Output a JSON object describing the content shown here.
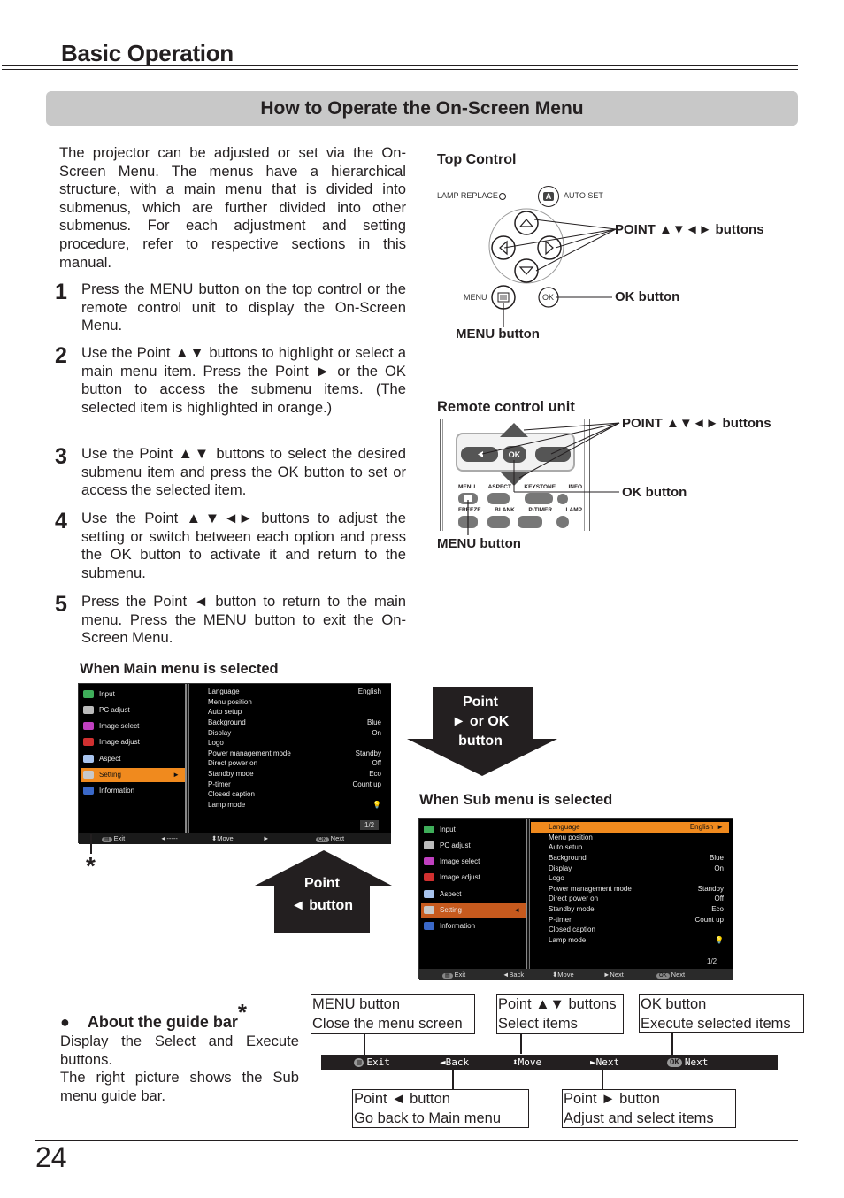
{
  "header": {
    "section_title": "Basic Operation",
    "banner_title": "How to Operate the On-Screen Menu"
  },
  "intro": "The projector can be adjusted or set via the On-Screen Menu. The menus have a hierarchical structure, with a main menu that is divided into submenus, which are further divided into other submenus. For each adjustment and setting procedure, refer to respective sections in this manual.",
  "steps": [
    {
      "num": "1",
      "text": "Press the MENU button on the top control or the remote control unit to display the On-Screen Menu."
    },
    {
      "num": "2",
      "text": "Use the Point ▲▼ buttons to highlight or select a main menu item. Press the Point ► or the OK button to access the submenu items. (The selected item is highlighted in orange.)"
    },
    {
      "num": "3",
      "text": "Use the Point ▲▼ buttons to select the desired submenu item and press the OK button to set or access the selected item."
    },
    {
      "num": "4",
      "text": "Use the Point ▲▼◄► buttons to adjust the setting or switch between each option and press the OK button to activate it and return to the submenu."
    },
    {
      "num": "5",
      "text": "Press the Point ◄ button to return to the main menu. Press the MENU button to exit the On-Screen Menu."
    }
  ],
  "top_control": {
    "title": "Top Control",
    "lamp_replace": "LAMP REPLACE",
    "auto_set": "AUTO SET",
    "auto_set_glyph": "A",
    "menu_small": "MENU",
    "ok_small": "OK",
    "point_label": "POINT ▲▼◄► buttons",
    "ok_label": "OK button",
    "menu_label": "MENU button"
  },
  "remote": {
    "title": "Remote control unit",
    "point_label": "POINT ▲▼◄► buttons",
    "ok_label": "OK button",
    "menu_label": "MENU button",
    "ok_key": "OK",
    "keys_row1": [
      "MENU",
      "ASPECT",
      "KEYSTONE",
      "INFO"
    ],
    "keys_row2": [
      "FREEZE",
      "BLANK",
      "P-TIMER",
      "LAMP"
    ]
  },
  "main_menu_caption": "When Main menu is selected",
  "sub_menu_caption": "When Sub menu is selected",
  "osd": {
    "main_items": [
      {
        "label": "Input",
        "icon": "input-icon",
        "color": "#3fae5a"
      },
      {
        "label": "PC adjust",
        "icon": "pc-adjust-icon",
        "color": "#bbbbbb"
      },
      {
        "label": "Image select",
        "icon": "image-select-icon",
        "color": "#c040c0"
      },
      {
        "label": "Image adjust",
        "icon": "image-adjust-icon",
        "color": "#d03030"
      },
      {
        "label": "Aspect",
        "icon": "aspect-icon",
        "color": "#a8c4ee"
      },
      {
        "label": "Setting",
        "icon": "setting-icon",
        "color": "#c8c8c8"
      },
      {
        "label": "Information",
        "icon": "information-icon",
        "color": "#3a68c8"
      }
    ],
    "sub_items": [
      {
        "label": "Language",
        "value": "English"
      },
      {
        "label": "Menu position",
        "value": ""
      },
      {
        "label": "Auto setup",
        "value": ""
      },
      {
        "label": "Background",
        "value": "Blue"
      },
      {
        "label": "Display",
        "value": "On"
      },
      {
        "label": "Logo",
        "value": ""
      },
      {
        "label": "Power management mode",
        "value": "Standby"
      },
      {
        "label": "Direct power on",
        "value": "Off"
      },
      {
        "label": "Standby mode",
        "value": "Eco"
      },
      {
        "label": "P-timer",
        "value": "Count up"
      },
      {
        "label": "Closed caption",
        "value": ""
      },
      {
        "label": "Lamp mode",
        "value": "💡"
      }
    ],
    "page": "1/2",
    "main_guide": {
      "exit": "Exit",
      "back": "◄-----",
      "move": "⬍Move",
      "next": "►",
      "ok_next": "Next",
      "ok_glyph": "OK"
    },
    "sub_guide": {
      "exit": "Exit",
      "back": "◄Back",
      "move": "⬍Move",
      "next": "►Next",
      "ok_next": "Next",
      "ok_glyph": "OK"
    },
    "highlight_color": "#f08a1e"
  },
  "arrows": {
    "down_line1": "Point",
    "down_line2": "► or OK",
    "down_line3": "button",
    "up_line1": "Point",
    "up_line2": "◄  button"
  },
  "asterisk": "*",
  "guide_bar_section": {
    "bullet": "●",
    "title": "About the guide bar",
    "title_mark": "*",
    "desc1": "Display the Select and Execute buttons.",
    "desc2": "The right picture shows the Sub menu guide bar.",
    "bar": {
      "exit": "Exit",
      "back": "◄Back",
      "move": "⬍Move",
      "next": "►Next",
      "ok_glyph": "OK",
      "ok_next": "Next"
    },
    "callouts": {
      "menu": [
        "MENU button",
        "Close the menu screen"
      ],
      "updown": [
        "Point ▲▼ buttons",
        "Select items"
      ],
      "ok": [
        "OK button",
        "Execute selected items"
      ],
      "left": [
        "Point ◄ button",
        "Go back to Main menu"
      ],
      "right": [
        "Point ► button",
        "Adjust and select items"
      ]
    }
  },
  "page_number": "24"
}
